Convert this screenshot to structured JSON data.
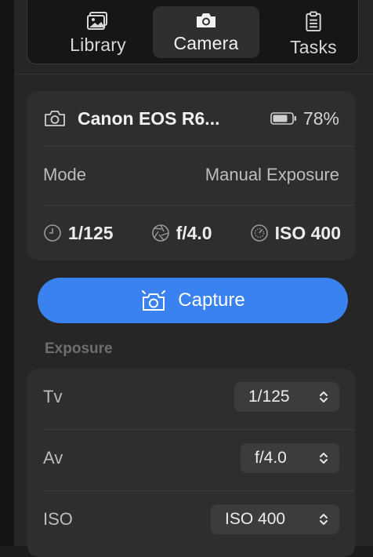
{
  "tabs": [
    {
      "label": "Library",
      "icon": "photo-library-icon",
      "active": false
    },
    {
      "label": "Camera",
      "icon": "camera-icon",
      "active": true
    },
    {
      "label": "Tasks",
      "icon": "clipboard-icon",
      "active": false
    }
  ],
  "camera": {
    "name": "Canon EOS R6...",
    "battery": "78%",
    "mode_label": "Mode",
    "mode_value": "Manual Exposure",
    "shutter": "1/125",
    "aperture": "f/4.0",
    "iso": "ISO 400"
  },
  "capture": {
    "label": "Capture"
  },
  "exposure": {
    "section_label": "Exposure",
    "settings": [
      {
        "label": "Tv",
        "value": "1/125"
      },
      {
        "label": "Av",
        "value": "f/4.0"
      },
      {
        "label": "ISO",
        "value": "ISO 400"
      }
    ]
  },
  "colors": {
    "accent": "#3a82f0",
    "background": "#262626",
    "card": "#2e2e2e"
  }
}
